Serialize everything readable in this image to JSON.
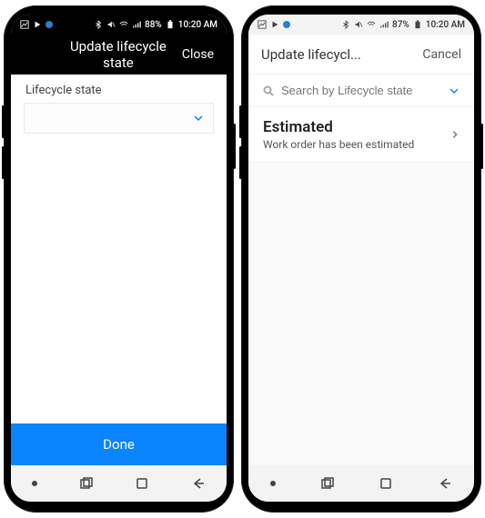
{
  "phones": {
    "left": {
      "statusbar": {
        "battery": "88%",
        "time": "10:20 AM"
      },
      "header": {
        "title": "Update lifecycle state",
        "close": "Close"
      },
      "form": {
        "field_label": "Lifecycle state"
      },
      "footer": {
        "done": "Done"
      }
    },
    "right": {
      "statusbar": {
        "battery": "87%",
        "time": "10:20 AM"
      },
      "header": {
        "title": "Update lifecycl...",
        "cancel": "Cancel"
      },
      "search": {
        "placeholder": "Search by Lifecycle state"
      },
      "list": {
        "item0": {
          "title": "Estimated",
          "subtitle": "Work order has been estimated"
        }
      }
    }
  },
  "colors": {
    "accent": "#0a84ff"
  }
}
